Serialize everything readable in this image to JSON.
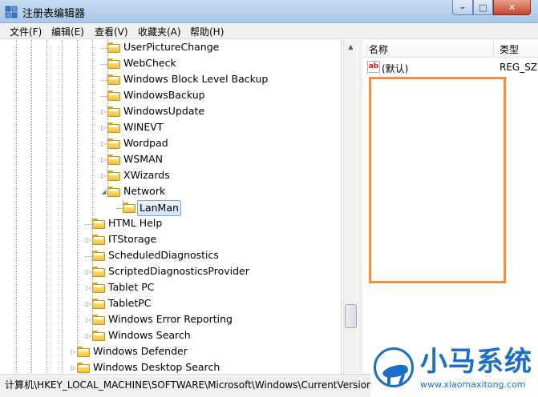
{
  "window": {
    "title": "注册表编辑器",
    "controls": {
      "minimize": "–",
      "maximize": "□",
      "close": "✕"
    }
  },
  "menu": {
    "items": [
      {
        "label": "文件(F)"
      },
      {
        "label": "编辑(E)"
      },
      {
        "label": "查看(V)"
      },
      {
        "label": "收藏夹(A)"
      },
      {
        "label": "帮助(H)"
      }
    ]
  },
  "tree": {
    "items": [
      {
        "label": "UserPictureChange",
        "level": 3,
        "expander": "none"
      },
      {
        "label": "WebCheck",
        "level": 3,
        "expander": "none"
      },
      {
        "label": "Windows Block Level Backup",
        "level": 3,
        "expander": "none"
      },
      {
        "label": "WindowsBackup",
        "level": 3,
        "expander": "none"
      },
      {
        "label": "WindowsUpdate",
        "level": 3,
        "expander": "collapsed"
      },
      {
        "label": "WINEVT",
        "level": 3,
        "expander": "collapsed"
      },
      {
        "label": "Wordpad",
        "level": 3,
        "expander": "collapsed"
      },
      {
        "label": "WSMAN",
        "level": 3,
        "expander": "collapsed"
      },
      {
        "label": "XWizards",
        "level": 3,
        "expander": "collapsed"
      },
      {
        "label": "Network",
        "level": 3,
        "expander": "expanded"
      },
      {
        "label": "LanMan",
        "level": 4,
        "expander": "none",
        "selected": true
      },
      {
        "label": "HTML Help",
        "level": 2,
        "expander": "none"
      },
      {
        "label": "ITStorage",
        "level": 2,
        "expander": "collapsed"
      },
      {
        "label": "ScheduledDiagnostics",
        "level": 2,
        "expander": "none"
      },
      {
        "label": "ScriptedDiagnosticsProvider",
        "level": 2,
        "expander": "collapsed"
      },
      {
        "label": "Tablet PC",
        "level": 2,
        "expander": "collapsed"
      },
      {
        "label": "TabletPC",
        "level": 2,
        "expander": "collapsed"
      },
      {
        "label": "Windows Error Reporting",
        "level": 2,
        "expander": "collapsed"
      },
      {
        "label": "Windows Search",
        "level": 2,
        "expander": "collapsed"
      },
      {
        "label": "Windows Defender",
        "level": 1,
        "expander": "collapsed"
      },
      {
        "label": "Windows Desktop Search",
        "level": 1,
        "expander": "collapsed"
      }
    ]
  },
  "list": {
    "columns": {
      "name": "名称",
      "type": "类型"
    },
    "rows": [
      {
        "icon": "ab",
        "name": "(默认)",
        "type": "REG_SZ"
      }
    ]
  },
  "status": {
    "path": "计算机\\HKEY_LOCAL_MACHINE\\SOFTWARE\\Microsoft\\Windows\\CurrentVersion"
  },
  "watermark": {
    "brand": "小马系统",
    "url": "www.xiaomaxitong.com"
  },
  "colors": {
    "highlight_box": "#f0903a",
    "brand": "#1b6fc8",
    "selection_border": "#7da2ce"
  }
}
